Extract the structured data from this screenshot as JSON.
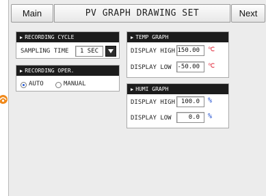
{
  "header": {
    "main_label": "Main",
    "title": "PV GRAPH DRAWING SET",
    "next_label": "Next"
  },
  "recording_cycle": {
    "title": "RECORDING CYCLE",
    "sampling_label": "SAMPLING TIME",
    "sampling_value": "1 SEC"
  },
  "recording_oper": {
    "title": "RECORDING OPER.",
    "options": [
      "AUTO",
      "MANUAL"
    ],
    "selected": "AUTO"
  },
  "temp_graph": {
    "title": "TEMP GRAPH",
    "high_label": "DISPLAY HIGH",
    "high_value": "150.00",
    "low_label": "DISPLAY LOW",
    "low_value": "-50.00",
    "unit": "℃",
    "unit_color": "#e0283a"
  },
  "humi_graph": {
    "title": "HUMI GRAPH",
    "high_label": "DISPLAY HIGH",
    "high_value": "100.0",
    "low_label": "DISPLAY LOW",
    "low_value": "0.0",
    "unit": "%",
    "unit_color": "#1f4fd0"
  },
  "colors": {
    "panel_header": "#1c1c1c",
    "background": "#ececec",
    "radio_selected": "#1f56d8"
  }
}
